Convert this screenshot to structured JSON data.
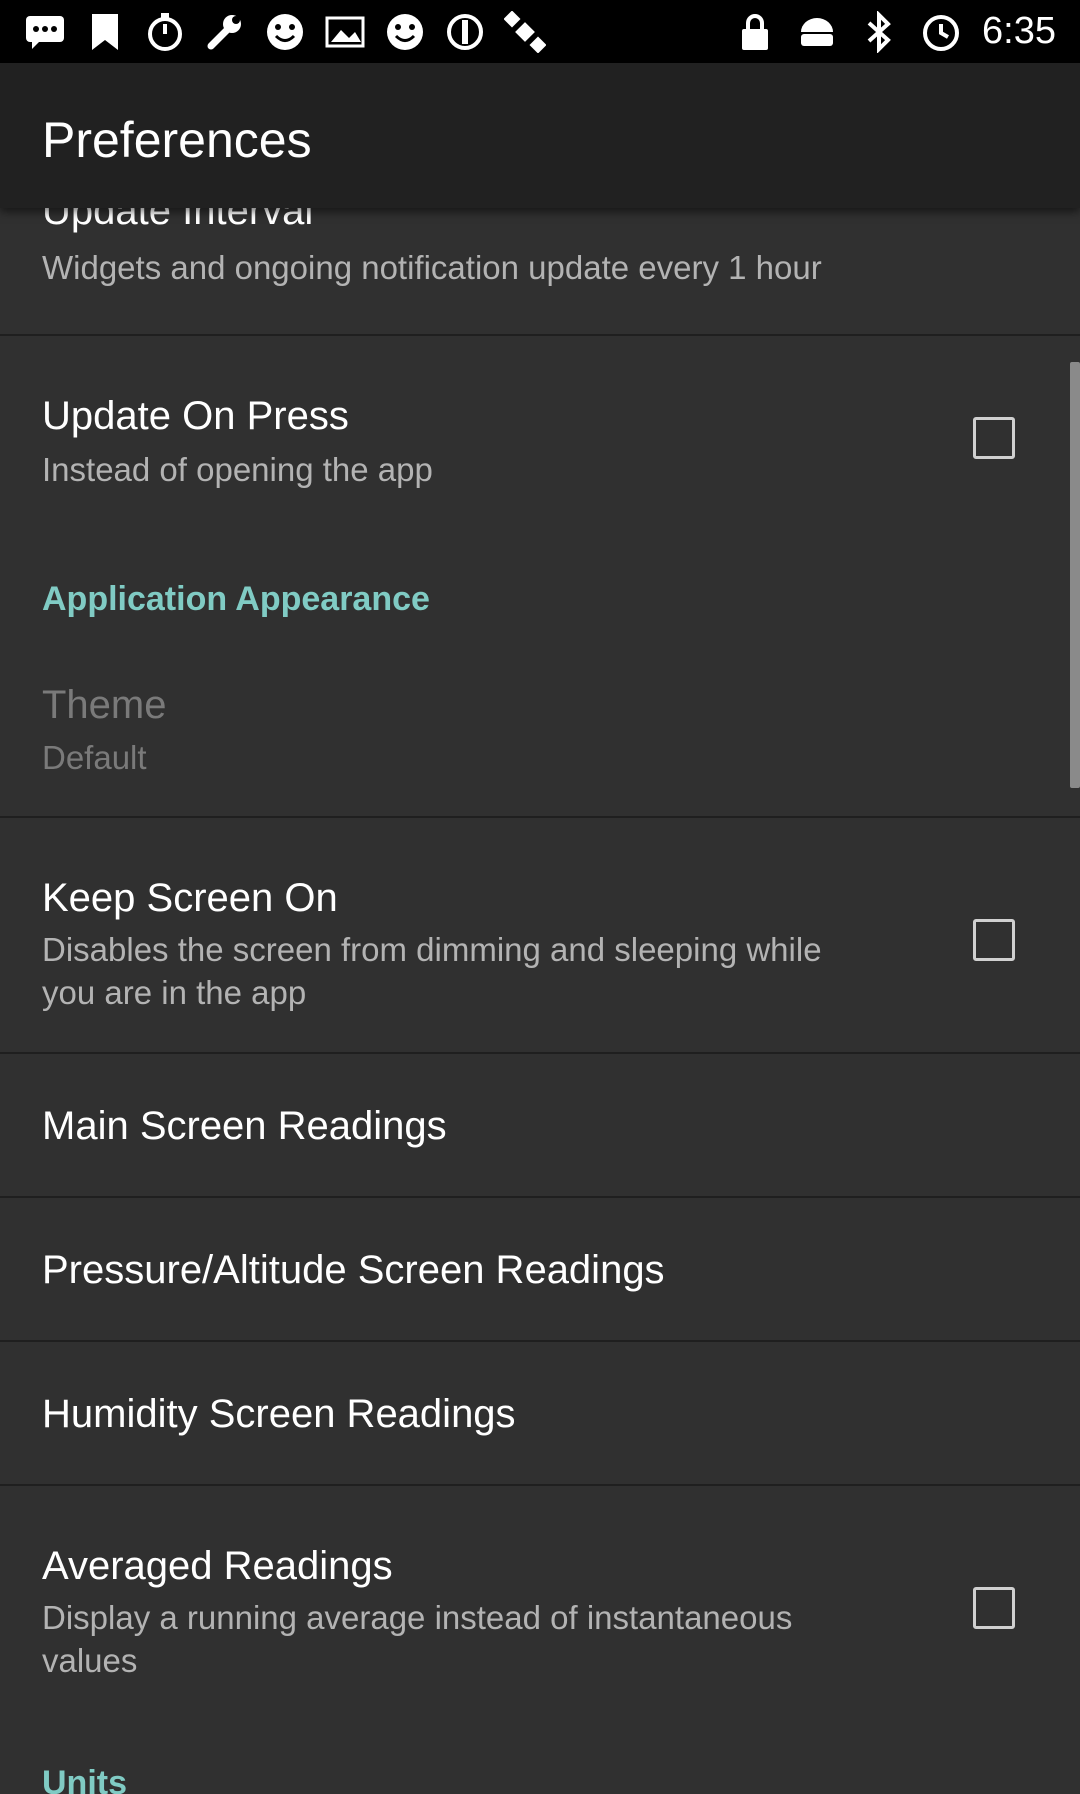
{
  "status_bar": {
    "time": "6:35",
    "left_icons": [
      "messages-icon",
      "bookmark-icon",
      "stopwatch-icon",
      "wrench-icon",
      "smiley-icon",
      "image-icon",
      "smiley-icon",
      "radio-icon",
      "satellite-icon"
    ],
    "right_icons": [
      "lock-icon",
      "android-icon",
      "bluetooth-icon",
      "alarm-icon"
    ]
  },
  "toolbar": {
    "title": "Preferences"
  },
  "preferences": {
    "update_interval": {
      "title": "Update Interval",
      "summary": "Widgets and ongoing notification update every 1 hour"
    },
    "update_on_press": {
      "title": "Update On Press",
      "summary": "Instead of opening the app",
      "checked": false
    },
    "category_appearance": "Application Appearance",
    "theme": {
      "title": "Theme",
      "summary": "Default",
      "enabled": false
    },
    "keep_screen_on": {
      "title": "Keep Screen On",
      "summary": "Disables the screen from dimming and sleeping while you are in the app",
      "checked": false
    },
    "main_screen_readings": {
      "title": "Main Screen Readings"
    },
    "pressure_altitude": {
      "title": "Pressure/Altitude Screen Readings"
    },
    "humidity": {
      "title": "Humidity Screen Readings"
    },
    "averaged_readings": {
      "title": "Averaged Readings",
      "summary": "Display a running average instead of instantaneous values",
      "checked": false
    },
    "category_units": "Units"
  },
  "colors": {
    "accent": "#80cbc4",
    "background": "#303030",
    "toolbar": "#212121"
  }
}
